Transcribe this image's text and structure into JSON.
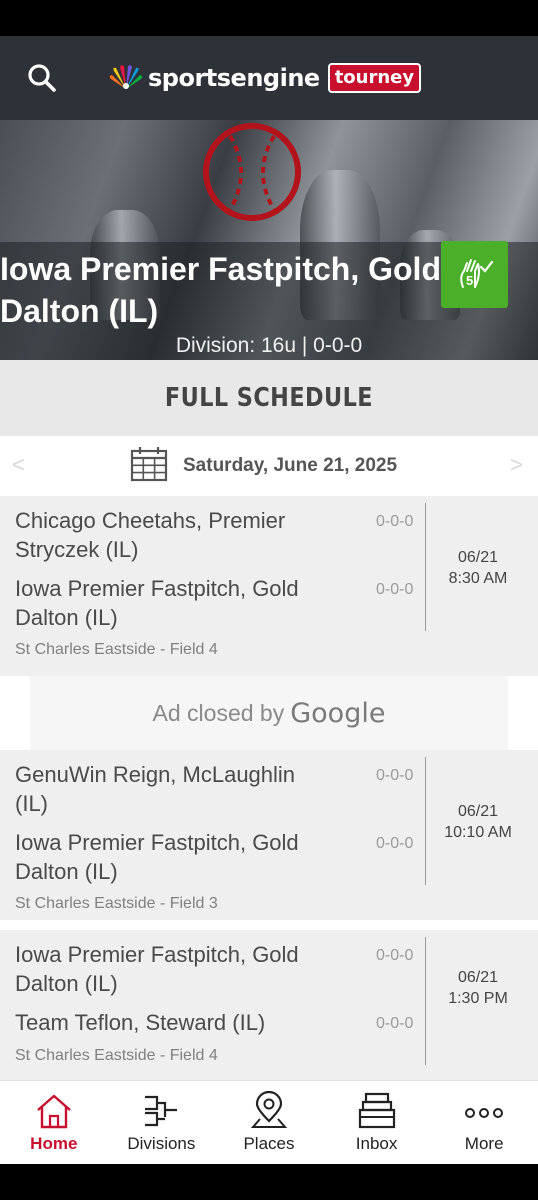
{
  "header": {
    "logo_word": "sportsengine",
    "logo_badge": "tourney",
    "search_icon": "search-icon",
    "peacock_icon": "peacock-logo-icon"
  },
  "hero": {
    "team_line1": "Iowa Premier Fastpitch, Gold",
    "team_line2": "Dalton (IL)",
    "division": "Division: 16u | 0-0-0",
    "badge_number": "5",
    "badge_icon": "hand-check-icon",
    "badge_color": "#4caf2a"
  },
  "schedule": {
    "heading": "FULL SCHEDULE",
    "date": "Saturday, June 21, 2025",
    "prev_icon": "chevron-left-icon",
    "next_icon": "chevron-right-icon"
  },
  "games": [
    {
      "home_line1": "Chicago Cheetahs, Premier",
      "home_line2": "Stryczek (IL)",
      "home_record": "0-0-0",
      "away_line1": "Iowa Premier Fastpitch, Gold",
      "away_line2": "Dalton (IL)",
      "away_record": "0-0-0",
      "date": "06/21",
      "time": "8:30 AM",
      "venue": "St Charles Eastside - Field 4"
    },
    {
      "home_line1": "GenuWin Reign, McLaughlin",
      "home_line2": "(IL)",
      "home_record": "0-0-0",
      "away_line1": "Iowa Premier Fastpitch, Gold",
      "away_line2": "Dalton (IL)",
      "away_record": "0-0-0",
      "date": "06/21",
      "time": "10:10 AM",
      "venue": "St Charles Eastside - Field 3"
    },
    {
      "home_line1": "Iowa Premier Fastpitch, Gold",
      "home_line2": "Dalton (IL)",
      "home_record": "0-0-0",
      "away_line1": "Team Teflon, Steward (IL)",
      "away_record": "0-0-0",
      "date": "06/21",
      "time": "1:30 PM",
      "venue": "St Charles Eastside - Field 4"
    }
  ],
  "ad": {
    "text": "Ad closed by",
    "brand": "Google"
  },
  "tabs": [
    {
      "label": "Home",
      "icon": "home-icon",
      "active": true
    },
    {
      "label": "Divisions",
      "icon": "bracket-icon",
      "active": false
    },
    {
      "label": "Places",
      "icon": "map-pin-icon",
      "active": false
    },
    {
      "label": "Inbox",
      "icon": "inbox-icon",
      "active": false
    },
    {
      "label": "More",
      "icon": "more-dots-icon",
      "active": false
    }
  ],
  "colors": {
    "accent": "#c8102e",
    "header_bg": "#2e3238",
    "row_bg": "#efefef"
  }
}
